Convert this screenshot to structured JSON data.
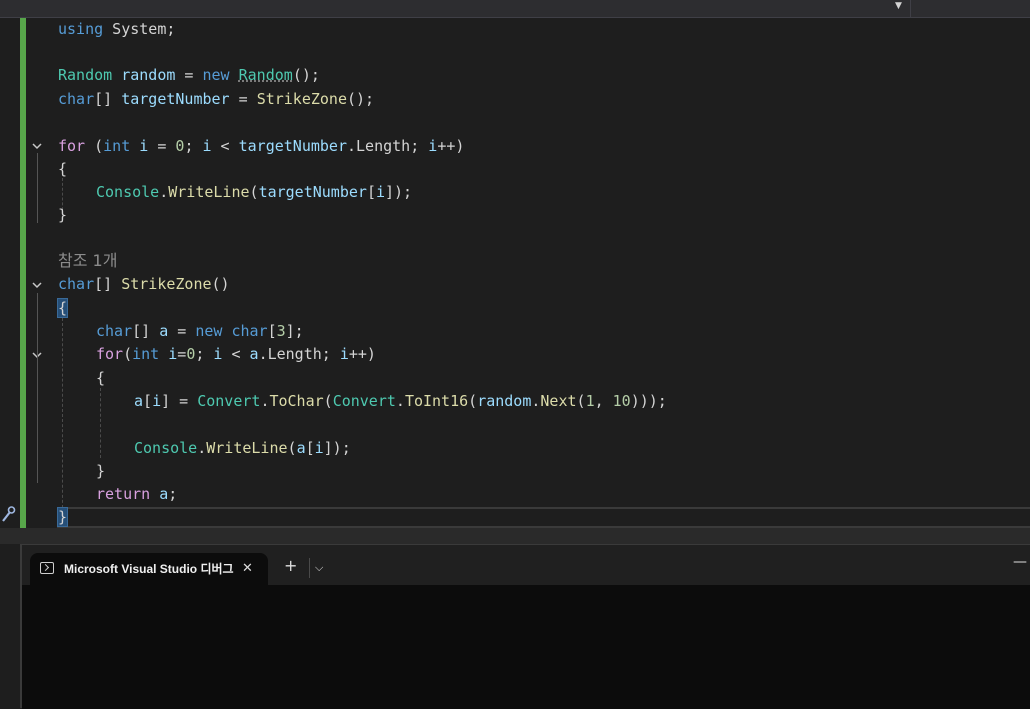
{
  "top_bar": {
    "dropdown_icon": "chevron-down-icon"
  },
  "code": {
    "l1": {
      "kw": "using",
      "rest": " System;"
    },
    "l2": {
      "type1": "Random",
      "var": " random",
      "eq": " = ",
      "kw": "new",
      "sp": " ",
      "ctor": "Random",
      "end": "();"
    },
    "l3": {
      "kw": "char",
      "mid": "[] ",
      "var": "targetNumber",
      "eq": " = ",
      "fn": "StrikeZone",
      "end": "();"
    },
    "l4": {
      "kw": "for",
      "p1": " (",
      "kw2": "int",
      "v1": " i",
      "p2": " = ",
      "n1": "0",
      "p3": "; ",
      "v2": "i",
      "p4": " < ",
      "v3": "targetNumber",
      "p5": ".",
      "prop": "Length",
      "p6": "; ",
      "v4": "i",
      "end": "++)"
    },
    "l5": {
      "text": "{"
    },
    "l6": {
      "type": "Console",
      "dot": ".",
      "fn": "WriteLine",
      "p1": "(",
      "var": "targetNumber",
      "p2": "[",
      "idx": "i",
      "end": "]);"
    },
    "l7": {
      "text": "}"
    },
    "codelens": "참조 1개",
    "l8": {
      "kw": "char",
      "mid": "[] ",
      "fn": "StrikeZone",
      "end": "()"
    },
    "l9": {
      "text": "{"
    },
    "l10": {
      "kw": "char",
      "p1": "[] ",
      "var": "a",
      "p2": " = ",
      "kw2": "new",
      "sp": " ",
      "kw3": "char",
      "p3": "[",
      "num": "3",
      "end": "];"
    },
    "l11": {
      "kw": "for",
      "p1": "(",
      "kw2": "int",
      "v1": " i",
      "p2": "=",
      "n1": "0",
      "p3": "; ",
      "v2": "i",
      "p4": " < ",
      "v3": "a",
      "p5": ".",
      "prop": "Length",
      "p6": "; ",
      "v4": "i",
      "end": "++)"
    },
    "l12": {
      "text": "{"
    },
    "l13": {
      "var": "a",
      "p1": "[",
      "idx": "i",
      "p2": "] = ",
      "t1": "Convert",
      "d1": ".",
      "f1": "ToChar",
      "p3": "(",
      "t2": "Convert",
      "d2": ".",
      "f2": "ToInt16",
      "p4": "(",
      "v2": "random",
      "d3": ".",
      "f3": "Next",
      "p5": "(",
      "n1": "1",
      "p6": ", ",
      "n2": "10",
      "end": ")));"
    },
    "l14": {
      "type": "Console",
      "dot": ".",
      "fn": "WriteLine",
      "p1": "(",
      "var": "a",
      "p2": "[",
      "idx": "i",
      "end": "]);"
    },
    "l15": {
      "text": "}"
    },
    "l16": {
      "kw": "return",
      "rest": " ",
      "var": "a",
      "end": ";"
    },
    "l17": {
      "text": "}"
    }
  },
  "terminal": {
    "tab_icon": "console-icon",
    "tab_label": "Microsoft Visual Studio 디버그",
    "tab_close": "✕",
    "new_tab": "+",
    "dropdown": "⌵",
    "minimize": "—"
  },
  "colors": {
    "keyword": "#569cd6",
    "type": "#4ec9b0",
    "method": "#dcdcaa",
    "variable": "#9cdcfe",
    "number": "#b5cea8",
    "change_bar": "#57a64a"
  }
}
